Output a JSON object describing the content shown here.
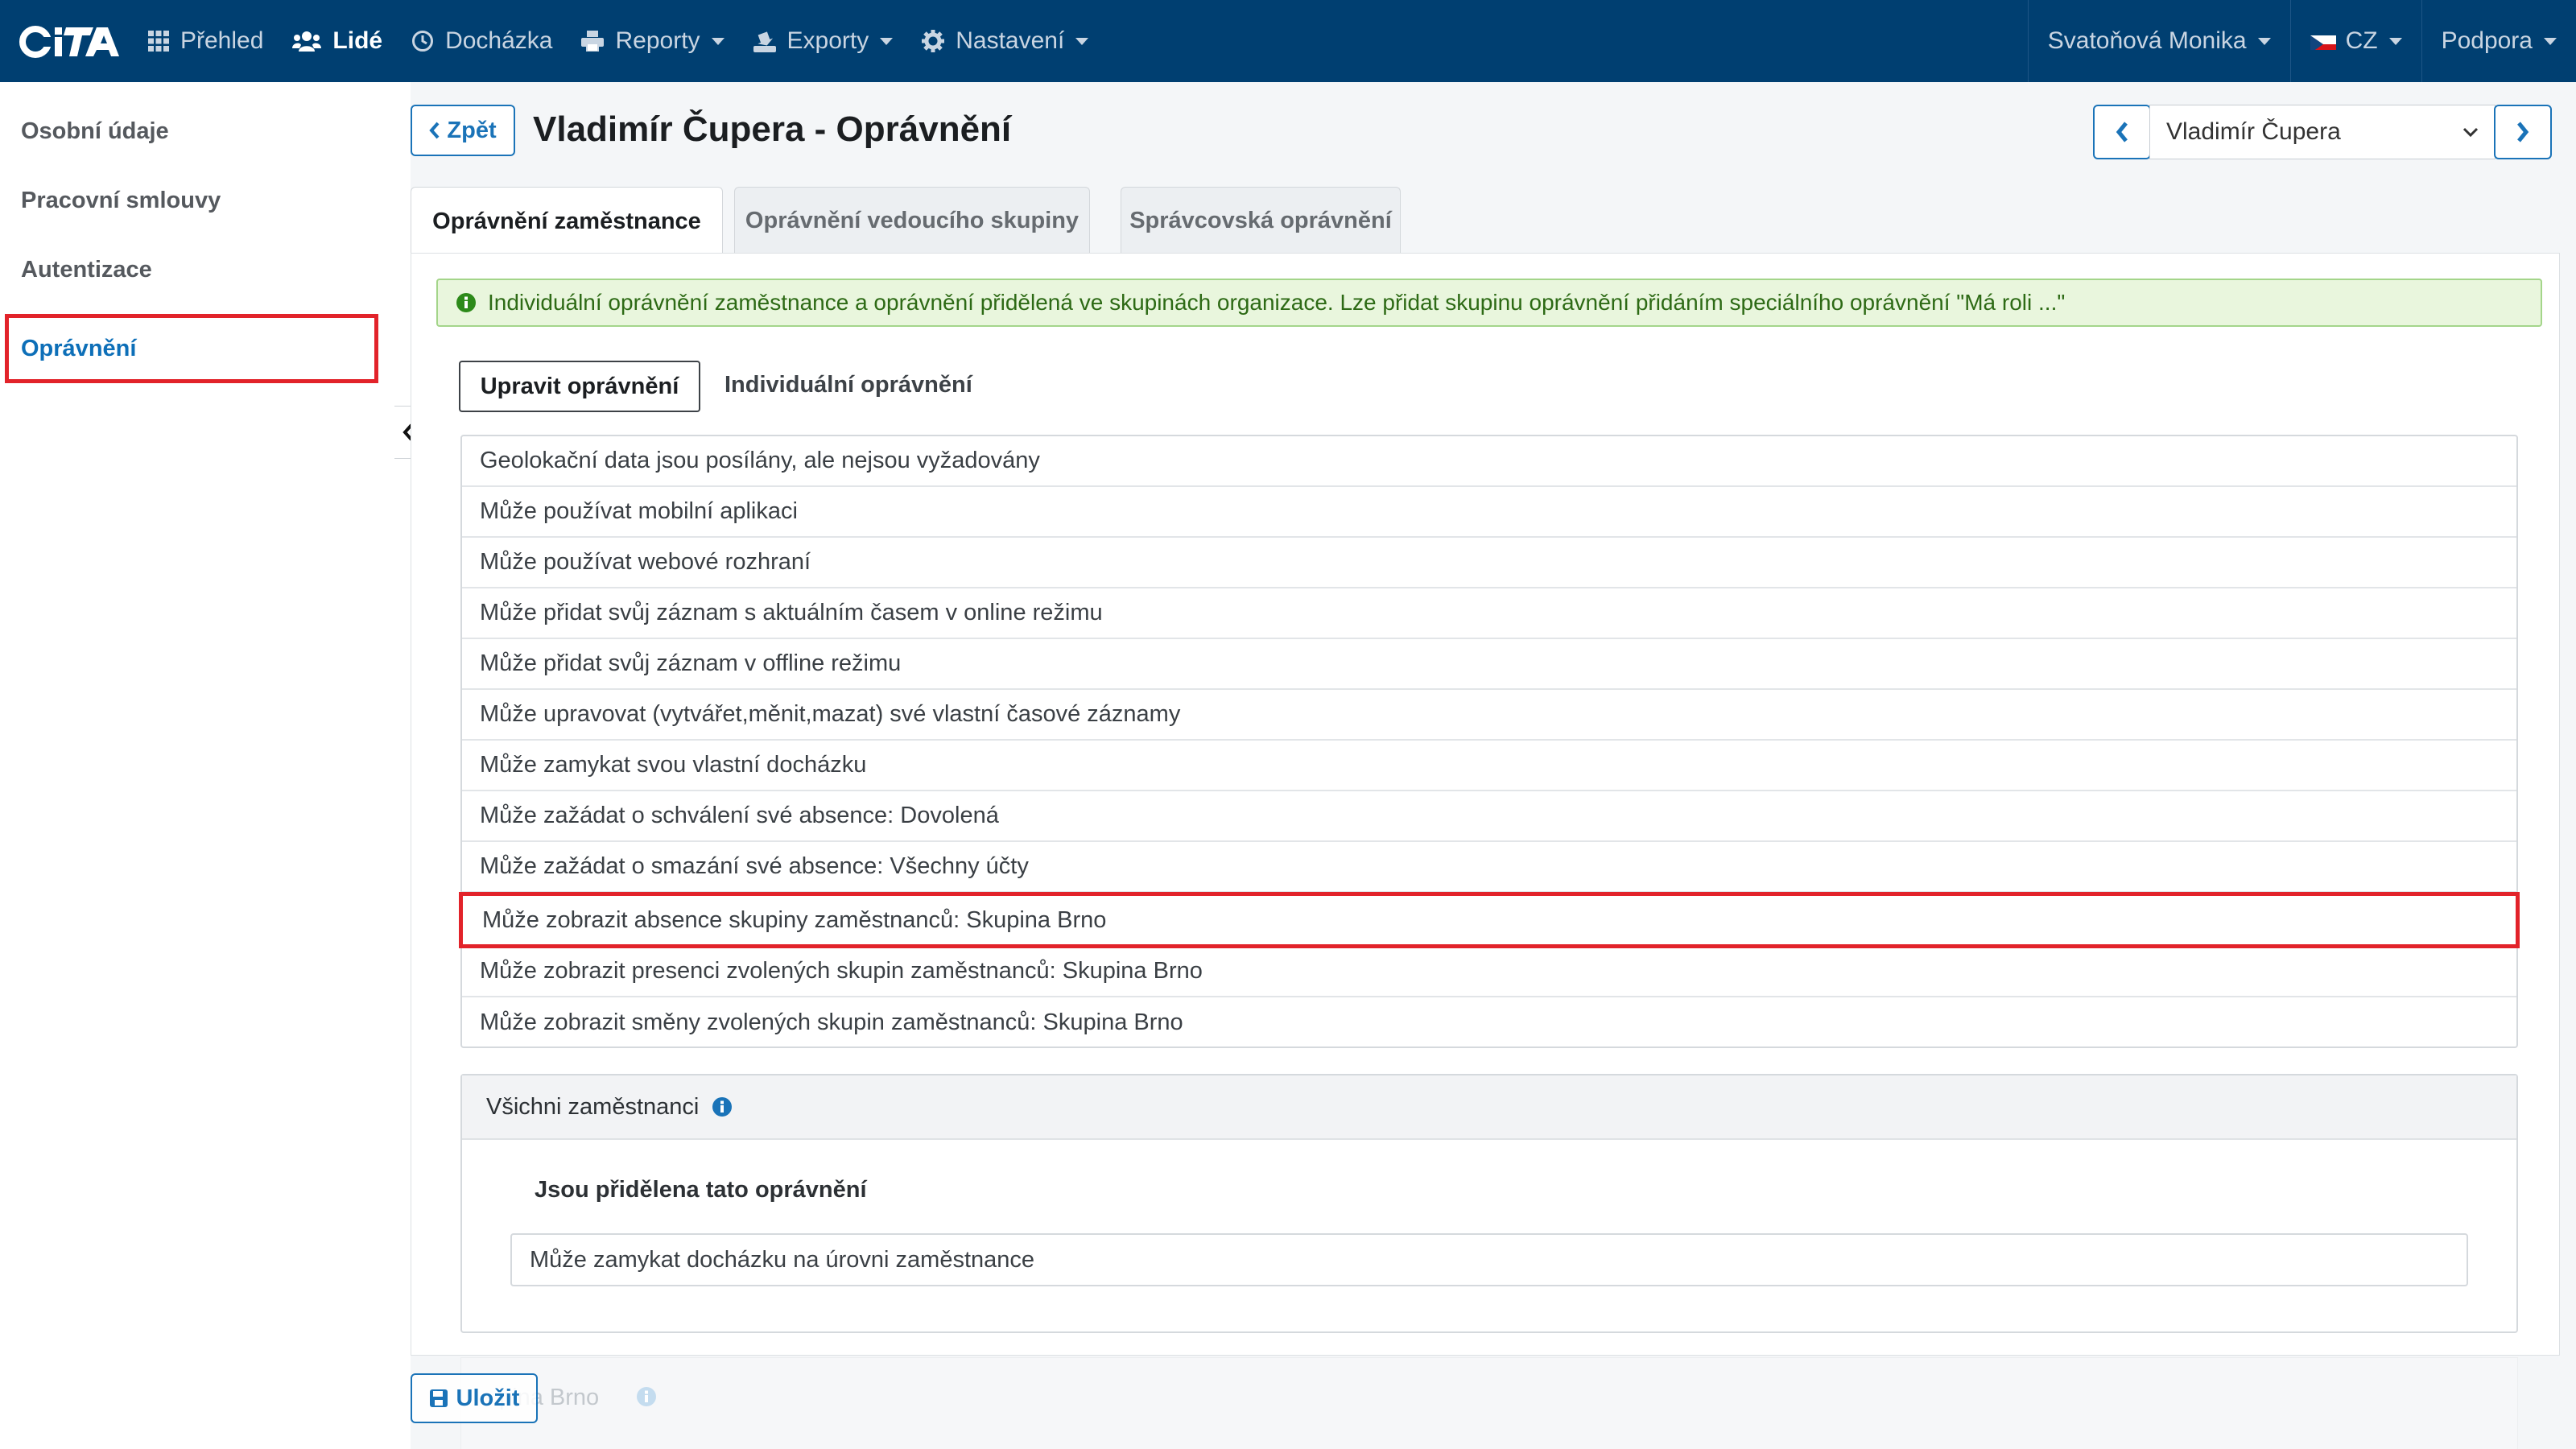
{
  "nav": {
    "logo_text": "CiTA",
    "items": [
      {
        "label": "Přehled",
        "icon": "grid-icon"
      },
      {
        "label": "Lidé",
        "icon": "users-icon"
      },
      {
        "label": "Docházka",
        "icon": "clock-icon"
      },
      {
        "label": "Reporty",
        "icon": "print-icon"
      },
      {
        "label": "Exporty",
        "icon": "export-icon"
      },
      {
        "label": "Nastavení",
        "icon": "gear-icon"
      }
    ],
    "user": "Svatoňová Monika",
    "language": "CZ",
    "support": "Podpora",
    "colors": {
      "bar": "#003f71",
      "accent": "#1a73b8",
      "highlight": "#e2232a"
    }
  },
  "sidebar": {
    "items": [
      {
        "label": "Osobní údaje"
      },
      {
        "label": "Pracovní smlouvy"
      },
      {
        "label": "Autentizace"
      },
      {
        "label": "Oprávnění"
      }
    ]
  },
  "header": {
    "back_label": "Zpět",
    "title": "Vladimír Čupera - Oprávnění",
    "employee_select": "Vladimír Čupera"
  },
  "tabs": [
    {
      "label": "Oprávnění zaměstnance"
    },
    {
      "label": "Oprávnění vedoucího skupiny"
    },
    {
      "label": "Správcovská oprávnění"
    }
  ],
  "alert": {
    "text": "Individuální oprávnění zaměstnance a oprávnění přidělená ve skupinách organizace. Lze přidat skupinu oprávnění přidáním speciálního oprávnění \"Má roli ...\""
  },
  "subtabs": {
    "edit_label": "Upravit oprávnění",
    "individual_label": "Individuální oprávnění"
  },
  "permissions": [
    "Geolokační data jsou posílány, ale nejsou vyžadovány",
    "Může používat mobilní aplikaci",
    "Může používat webové rozhraní",
    "Může přidat svůj záznam s aktuálním časem v online režimu",
    "Může přidat svůj záznam v offline režimu",
    "Může upravovat (vytvářet,měnit,mazat) své vlastní časové záznamy",
    "Může zamykat svou vlastní docházku",
    "Může zažádat o schválení své absence: Dovolená",
    "Může zažádat o smazání své absence: Všechny účty",
    "Může zobrazit absence skupiny zaměstnanců: Skupina Brno",
    "Může zobrazit presenci zvolených skupin zaměstnanců: Skupina Brno",
    "Může zobrazit směny zvolených skupin zaměstnanců: Skupina Brno"
  ],
  "group_card": {
    "title": "Všichni zaměstnanci",
    "subtitle": "Jsou přidělena tato oprávnění",
    "field": "Může zamykat docházku na úrovni zaměstnance"
  },
  "faded_card": {
    "label": "pina Brno"
  },
  "save_label": "Uložit"
}
